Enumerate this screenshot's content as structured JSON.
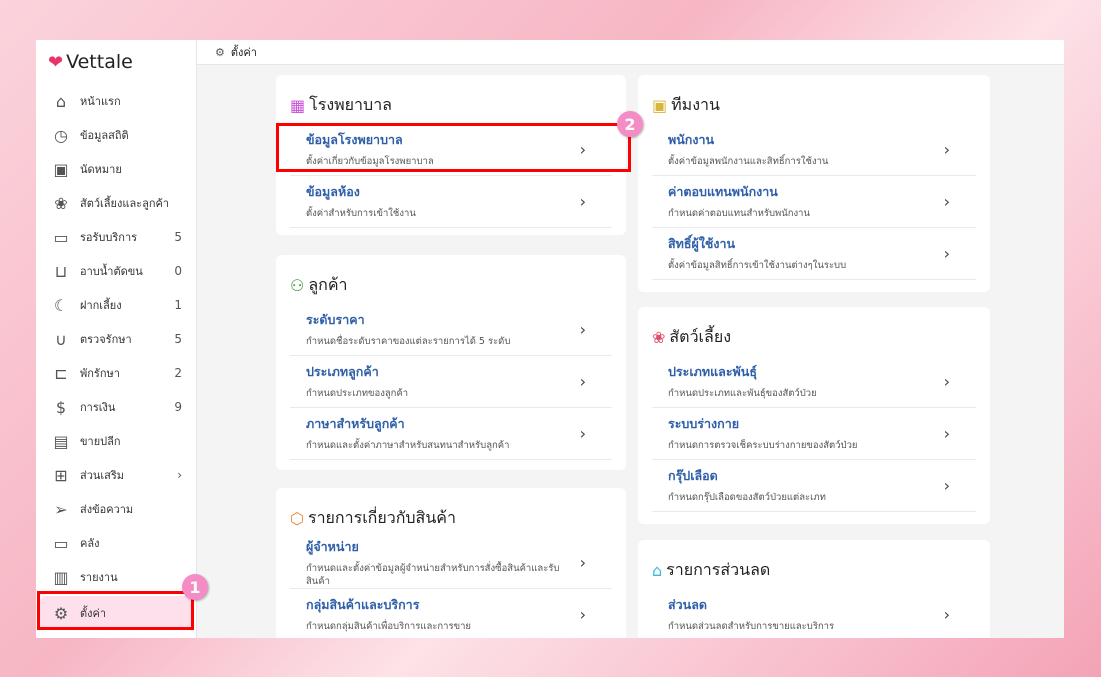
{
  "app": {
    "name": "Vettale"
  },
  "breadcrumb": "ตั้งค่า",
  "sidebar": [
    {
      "label": "หน้าแรก",
      "icon": "home-icon",
      "count": ""
    },
    {
      "label": "ข้อมูลสถิติ",
      "icon": "gauge-icon",
      "count": ""
    },
    {
      "label": "นัดหมาย",
      "icon": "calendar-icon",
      "count": ""
    },
    {
      "label": "สัตว์เลี้ยงและลูกค้า",
      "icon": "paw-icon",
      "count": ""
    },
    {
      "label": "รอรับบริการ",
      "icon": "sofa-icon",
      "count": "5"
    },
    {
      "label": "อาบน้ำตัดขน",
      "icon": "bathtub-icon",
      "count": "0"
    },
    {
      "label": "ฝากเลี้ยง",
      "icon": "moon-icon",
      "count": "1"
    },
    {
      "label": "ตรวจรักษา",
      "icon": "stethoscope-icon",
      "count": "5"
    },
    {
      "label": "พักรักษา",
      "icon": "bed-icon",
      "count": "2"
    },
    {
      "label": "การเงิน",
      "icon": "money-hand-icon",
      "count": "9"
    },
    {
      "label": "ขายปลีก",
      "icon": "cash-register-icon",
      "count": ""
    },
    {
      "label": "ส่วนเสริม",
      "icon": "plus-box-icon",
      "count": "›"
    },
    {
      "label": "ส่งข้อความ",
      "icon": "send-icon",
      "count": ""
    },
    {
      "label": "คลัง",
      "icon": "archive-icon",
      "count": ""
    },
    {
      "label": "รายงาน",
      "icon": "bar-chart-icon",
      "count": ""
    },
    {
      "label": "ตั้งค่า",
      "icon": "gear-icon",
      "count": ""
    }
  ],
  "annotations": [
    "1",
    "2"
  ],
  "sections": {
    "hospital": {
      "title": "โรงพยาบาล",
      "items": [
        {
          "t": "ข้อมูลโรงพยาบาล",
          "s": "ตั้งค่าเกี่ยวกับข้อมูลโรงพยาบาล"
        },
        {
          "t": "ข้อมูลห้อง",
          "s": "ตั้งค่าสำหรับการเข้าใช้งาน"
        }
      ]
    },
    "customer": {
      "title": "ลูกค้า",
      "items": [
        {
          "t": "ระดับราคา",
          "s": "กำหนดชื่อระดับราคาของแต่ละรายการได้ 5 ระดับ"
        },
        {
          "t": "ประเภทลูกค้า",
          "s": "กำหนดประเภทของลูกค้า"
        },
        {
          "t": "ภาษาสำหรับลูกค้า",
          "s": "กำหนดและตั้งค่าภาษาสำหรับสนทนาสำหรับลูกค้า"
        }
      ]
    },
    "product": {
      "title": "รายการเกี่ยวกับสินค้า",
      "items": [
        {
          "t": "ผู้จำหน่าย",
          "s": "กำหนดและตั้งค่าข้อมูลผู้จำหน่ายสำหรับการสั่งซื้อสินค้าและรับสินค้า"
        },
        {
          "t": "กลุ่มสินค้าและบริการ",
          "s": "กำหนดกลุ่มสินค้าเพื่อบริการและการขาย"
        }
      ]
    },
    "team": {
      "title": "ทีมงาน",
      "items": [
        {
          "t": "พนักงาน",
          "s": "ตั้งค่าข้อมูลพนักงานและสิทธิ์การใช้งาน"
        },
        {
          "t": "ค่าตอบแทนพนักงาน",
          "s": "กำหนดค่าตอบแทนสำหรับพนักงาน"
        },
        {
          "t": "สิทธิ์ผู้ใช้งาน",
          "s": "ตั้งค่าข้อมูลสิทธิ์การเข้าใช้งานต่างๆในระบบ"
        }
      ]
    },
    "pets": {
      "title": "สัตว์เลี้ยง",
      "items": [
        {
          "t": "ประเภทและพันธุ์",
          "s": "กำหนดประเภทและพันธุ์ของสัตว์ป่วย"
        },
        {
          "t": "ระบบร่างกาย",
          "s": "กำหนดการตรวจเช็คระบบร่างกายของสัตว์ป่วย"
        },
        {
          "t": "กรุ๊ปเลือด",
          "s": "กำหนดกรุ๊ปเลือดของสัตว์ป่วยแต่ละเภท"
        }
      ]
    },
    "discount": {
      "title": "รายการส่วนลด",
      "items": [
        {
          "t": "ส่วนลด",
          "s": "กำหนดส่วนลดสำหรับการขายและบริการ"
        }
      ]
    }
  }
}
